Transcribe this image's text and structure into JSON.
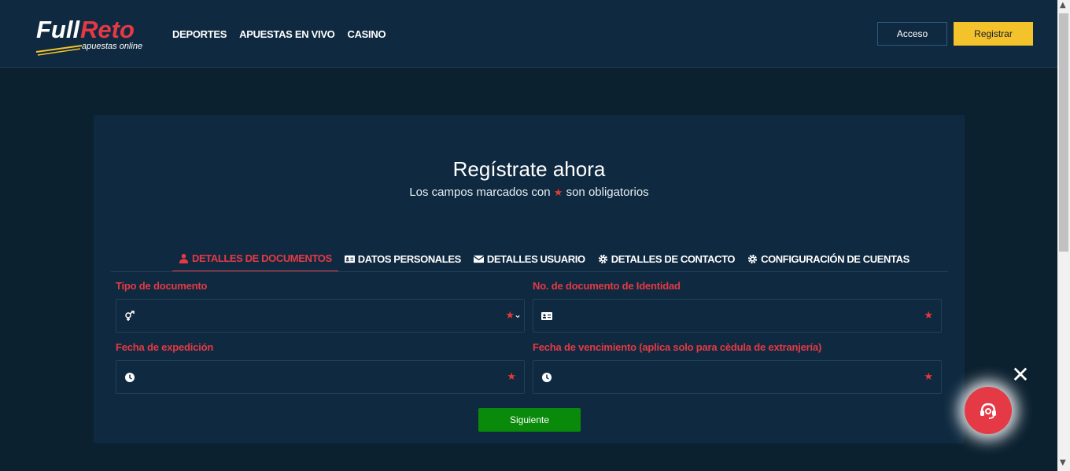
{
  "header": {
    "logo_text": "FullReto",
    "logo_tagline": "apuestas online",
    "nav": [
      "DEPORTES",
      "APUESTAS EN VIVO",
      "CASINO"
    ],
    "login_label": "Acceso",
    "register_label": "Registrar"
  },
  "form": {
    "title": "Regístrate ahora",
    "subtitle_before": "Los campos marcados con",
    "subtitle_star": "★",
    "subtitle_after": "son obligatorios",
    "tabs": [
      {
        "label": "DETALLES DE DOCUMENTOS",
        "icon": "user-icon",
        "active": true
      },
      {
        "label": "DATOS PERSONALES",
        "icon": "id-card-icon",
        "active": false
      },
      {
        "label": "DETALLES USUARIO",
        "icon": "envelope-icon",
        "active": false
      },
      {
        "label": "DETALLES DE CONTACTO",
        "icon": "gear-icon",
        "active": false
      },
      {
        "label": "CONFIGURACIÓN DE CUENTAS",
        "icon": "gear-icon",
        "active": false
      }
    ],
    "fields": {
      "doc_type_label": "Tipo de documento",
      "doc_type_value": "",
      "doc_number_label": "No. de documento de Identidad",
      "doc_number_value": "",
      "issue_date_label": "Fecha de expedición",
      "issue_date_value": "",
      "expiry_date_label": "Fecha de vencimiento (aplica solo para cèdula de extranjería)",
      "expiry_date_value": ""
    },
    "required_star": "★",
    "next_label": "Siguiente"
  },
  "support": {
    "close_glyph": "✕",
    "icon": "headset-icon"
  },
  "colors": {
    "background": "#0c2130",
    "panel": "#0f2a40",
    "accent_red": "#e53945",
    "register_yellow": "#f4c22b",
    "next_green": "#0a8a0a"
  }
}
